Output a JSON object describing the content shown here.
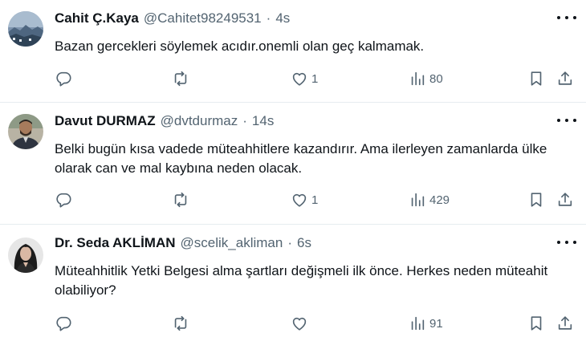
{
  "tweets": [
    {
      "name": "Cahit Ç.Kaya",
      "handle": "@Cahitet98249531",
      "separator": "·",
      "time": "4s",
      "text": "Bazan gercekleri söylemek acıdır.onemli olan geç kalmamak.",
      "likes": "1",
      "views": "80"
    },
    {
      "name": "Davut DURMAZ",
      "handle": "@dvtdurmaz",
      "separator": "·",
      "time": "14s",
      "text": "Belki bugün kısa vadede müteahhitlere kazandırır. Ama ilerleyen zamanlarda ülke olarak can ve mal kaybına neden olacak.",
      "likes": "1",
      "views": "429"
    },
    {
      "name": "Dr. Seda AKLİMAN",
      "handle": "@scelik_akliman",
      "separator": "·",
      "time": "6s",
      "text": "Müteahhitlik Yetki Belgesi alma şartları değişmeli ilk önce. Herkes neden müteahit olabiliyor?",
      "likes": "",
      "views": "91"
    }
  ],
  "icons": {
    "reply": "reply-icon",
    "retweet": "retweet-icon",
    "like": "heart-icon",
    "views": "views-icon",
    "bookmark": "bookmark-icon",
    "share": "share-icon",
    "more": "more-icon"
  },
  "colors": {
    "text": "#0f1419",
    "secondary": "#536471",
    "divider": "#e6ecf0"
  }
}
